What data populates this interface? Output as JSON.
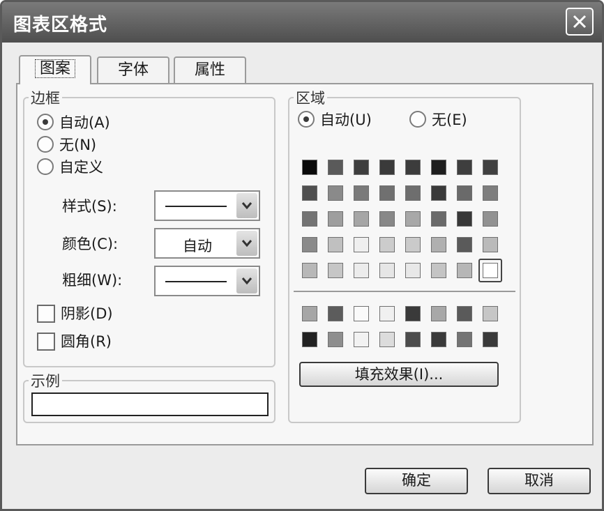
{
  "window": {
    "title": "图表区格式"
  },
  "tabs": [
    {
      "label": "图案"
    },
    {
      "label": "字体"
    },
    {
      "label": "属性"
    }
  ],
  "border_group": {
    "label": "边框",
    "options": [
      {
        "label": "自动(A)",
        "selected": true
      },
      {
        "label": "无(N)",
        "selected": false
      },
      {
        "label": "自定义",
        "selected": false
      }
    ],
    "style_label": "样式(S):",
    "color_label": "颜色(C):",
    "color_value": "自动",
    "weight_label": "粗细(W):",
    "shadow_label": "阴影(D)",
    "rounded_label": "圆角(R)"
  },
  "sample_group": {
    "label": "示例"
  },
  "area_group": {
    "label": "区域",
    "options": [
      {
        "label": "自动(U)",
        "selected": true
      },
      {
        "label": "无(E)",
        "selected": false
      }
    ],
    "palette_rows": [
      [
        "#0a0a0a",
        "#5a5a5a",
        "#3e3e3e",
        "#3a3a3a",
        "#3c3c3c",
        "#1e1e1e",
        "#3e3e3e",
        "#404040"
      ],
      [
        "#505050",
        "#8a8a8a",
        "#7a7a7a",
        "#707070",
        "#6e6e6e",
        "#3a3a3a",
        "#6a6a6a",
        "#7e7e7e"
      ],
      [
        "#747474",
        "#9e9e9e",
        "#a6a6a6",
        "#888888",
        "#a8a8a8",
        "#6a6a6a",
        "#383838",
        "#929292"
      ],
      [
        "#8a8a8a",
        "#c0c0c0",
        "#efefef",
        "#cccccc",
        "#cacaca",
        "#b0b0b0",
        "#5a5a5a",
        "#bababa"
      ],
      [
        "#b8b8b8",
        "#c6c6c6",
        "#ececec",
        "#e6e6e6",
        "#e8e8e8",
        "#c4c4c4",
        "#b6b6b6",
        "#ffffff"
      ]
    ],
    "extra_rows": [
      [
        "#a6a6a6",
        "#5c5c5c",
        "#fafafa",
        "#f0f0f0",
        "#3a3a3a",
        "#a8a8a8",
        "#5a5a5a",
        "#c6c6c6"
      ],
      [
        "#222222",
        "#8e8e8e",
        "#f2f2f2",
        "#dcdcdc",
        "#4c4c4c",
        "#3a3a3a",
        "#747474",
        "#3a3a3a"
      ]
    ],
    "fill_effects_label": "填充效果(I)..."
  },
  "buttons": {
    "ok": "确定",
    "cancel": "取消"
  }
}
